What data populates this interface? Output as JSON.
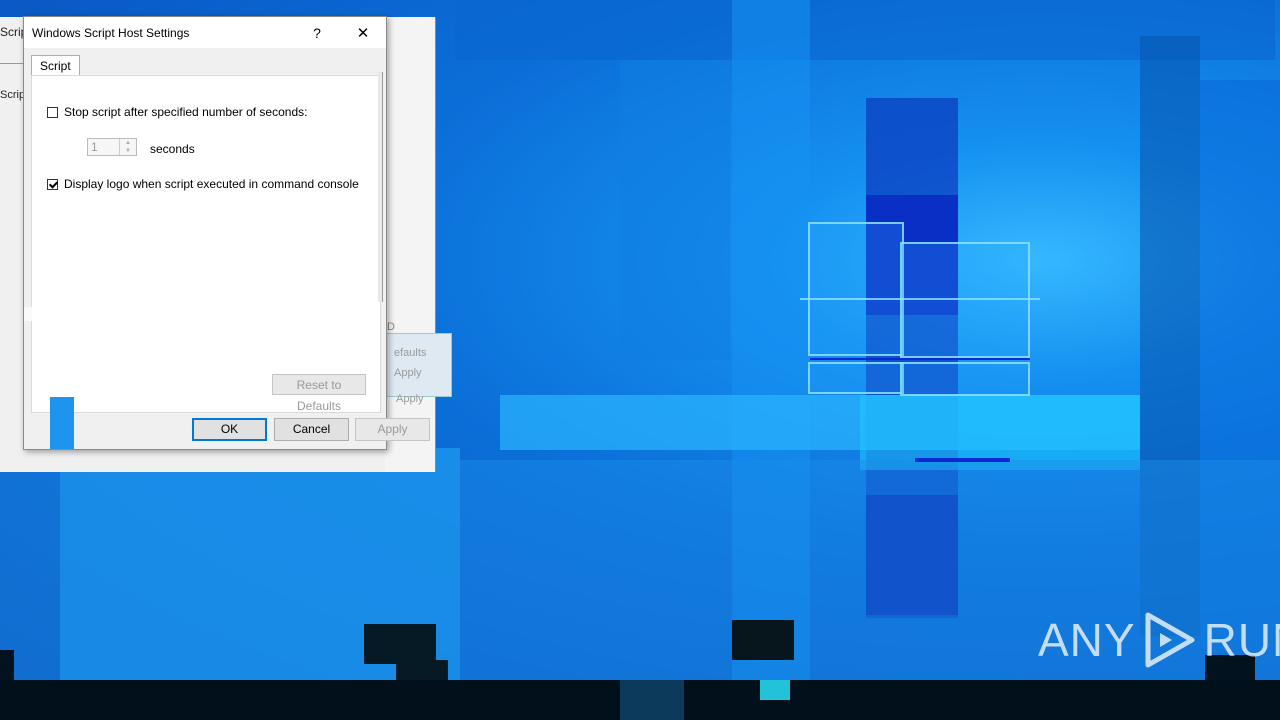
{
  "background_dialog": {
    "fragment_title": "Scrip",
    "fragment_tab": "Scrip",
    "fragment_defaults": "efaults",
    "fragment_apply_1": "Apply",
    "fragment_apply_2": "Apply",
    "fragment_d": "D"
  },
  "dialog": {
    "title": "Windows Script Host Settings",
    "help_glyph": "?",
    "close_glyph": "✕",
    "tabs": [
      {
        "label": "Script"
      }
    ],
    "stop_script": {
      "label": "Stop script after specified number of seconds:",
      "checked": false
    },
    "timeout": {
      "value": "1",
      "unit_label": "seconds",
      "enabled": false
    },
    "display_logo": {
      "label": "Display logo when script executed in command console",
      "checked": true
    },
    "reset_label": "Reset to Defaults",
    "ok_label": "OK",
    "cancel_label": "Cancel",
    "apply_label": "Apply"
  },
  "watermark": {
    "left_text": "ANY",
    "right_text": "RUN"
  },
  "colors": {
    "accent": "#0078d7",
    "wallpaper": "#0a78d7"
  }
}
